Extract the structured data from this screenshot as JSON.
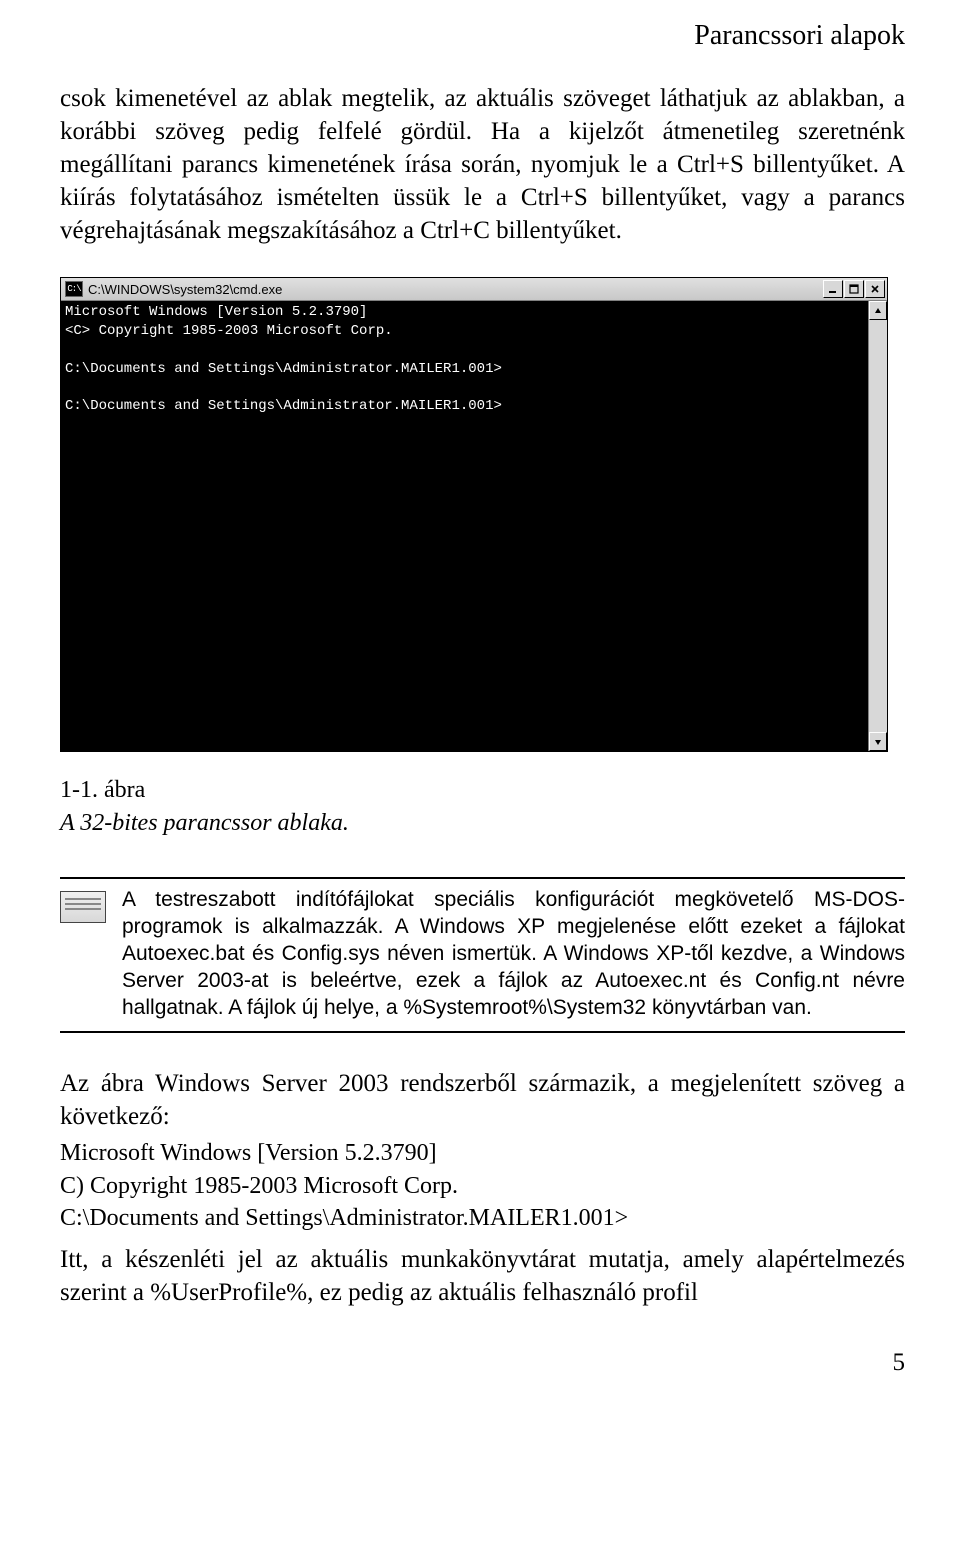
{
  "header": "Parancssori alapok",
  "para1": "csok kimenetével az ablak megtelik, az aktuális szöveget láthatjuk az ablakban, a korábbi szöveg pedig felfelé gördül. Ha a kijelzőt átmenetileg szeretnénk megállítani parancs kimenetének írása során, nyomjuk le a Ctrl+S billentyűket. A kiírás folytatásához ismételten üssük le a Ctrl+S billentyűket, vagy a parancs végrehajtásának megszakításához a Ctrl+C billentyűket.",
  "cmd": {
    "icon_text": "C:\\",
    "title": "C:\\WINDOWS\\system32\\cmd.exe",
    "lines": [
      "Microsoft Windows [Version 5.2.3790]",
      "<C> Copyright 1985-2003 Microsoft Corp.",
      "",
      "C:\\Documents and Settings\\Administrator.MAILER1.001>",
      "",
      "C:\\Documents and Settings\\Administrator.MAILER1.001>"
    ]
  },
  "figure": {
    "label": "1-1. ábra",
    "caption": "A 32-bites parancssor ablaka."
  },
  "note": "A testreszabott indítófájlokat speciális konfigurációt megkövetelő MS-DOS-programok is alkalmazzák. A Windows XP megjelenése előtt ezeket a fájlokat Autoexec.bat és Config.sys néven ismertük. A Windows XP-től kezdve, a Windows Server 2003-at is beleértve, ezek a fájlok az Autoexec.nt és Config.nt névre hallgatnak. A fájlok új helye, a %Systemroot%\\System32 könyvtárban van.",
  "para2": "Az ábra Windows Server 2003 rendszerből származik, a megjelenített szöveg a következő:",
  "codelines": [
    "Microsoft Windows [Version 5.2.3790]",
    "C) Copyright 1985-2003 Microsoft Corp.",
    "C:\\Documents and Settings\\Administrator.MAILER1.001>"
  ],
  "para3": "Itt, a készenléti jel az aktuális munkakönyvtárat mutatja, amely alapértelmezés szerint a %UserProfile%, ez pedig az aktuális felhasználó profil",
  "page_number": "5"
}
